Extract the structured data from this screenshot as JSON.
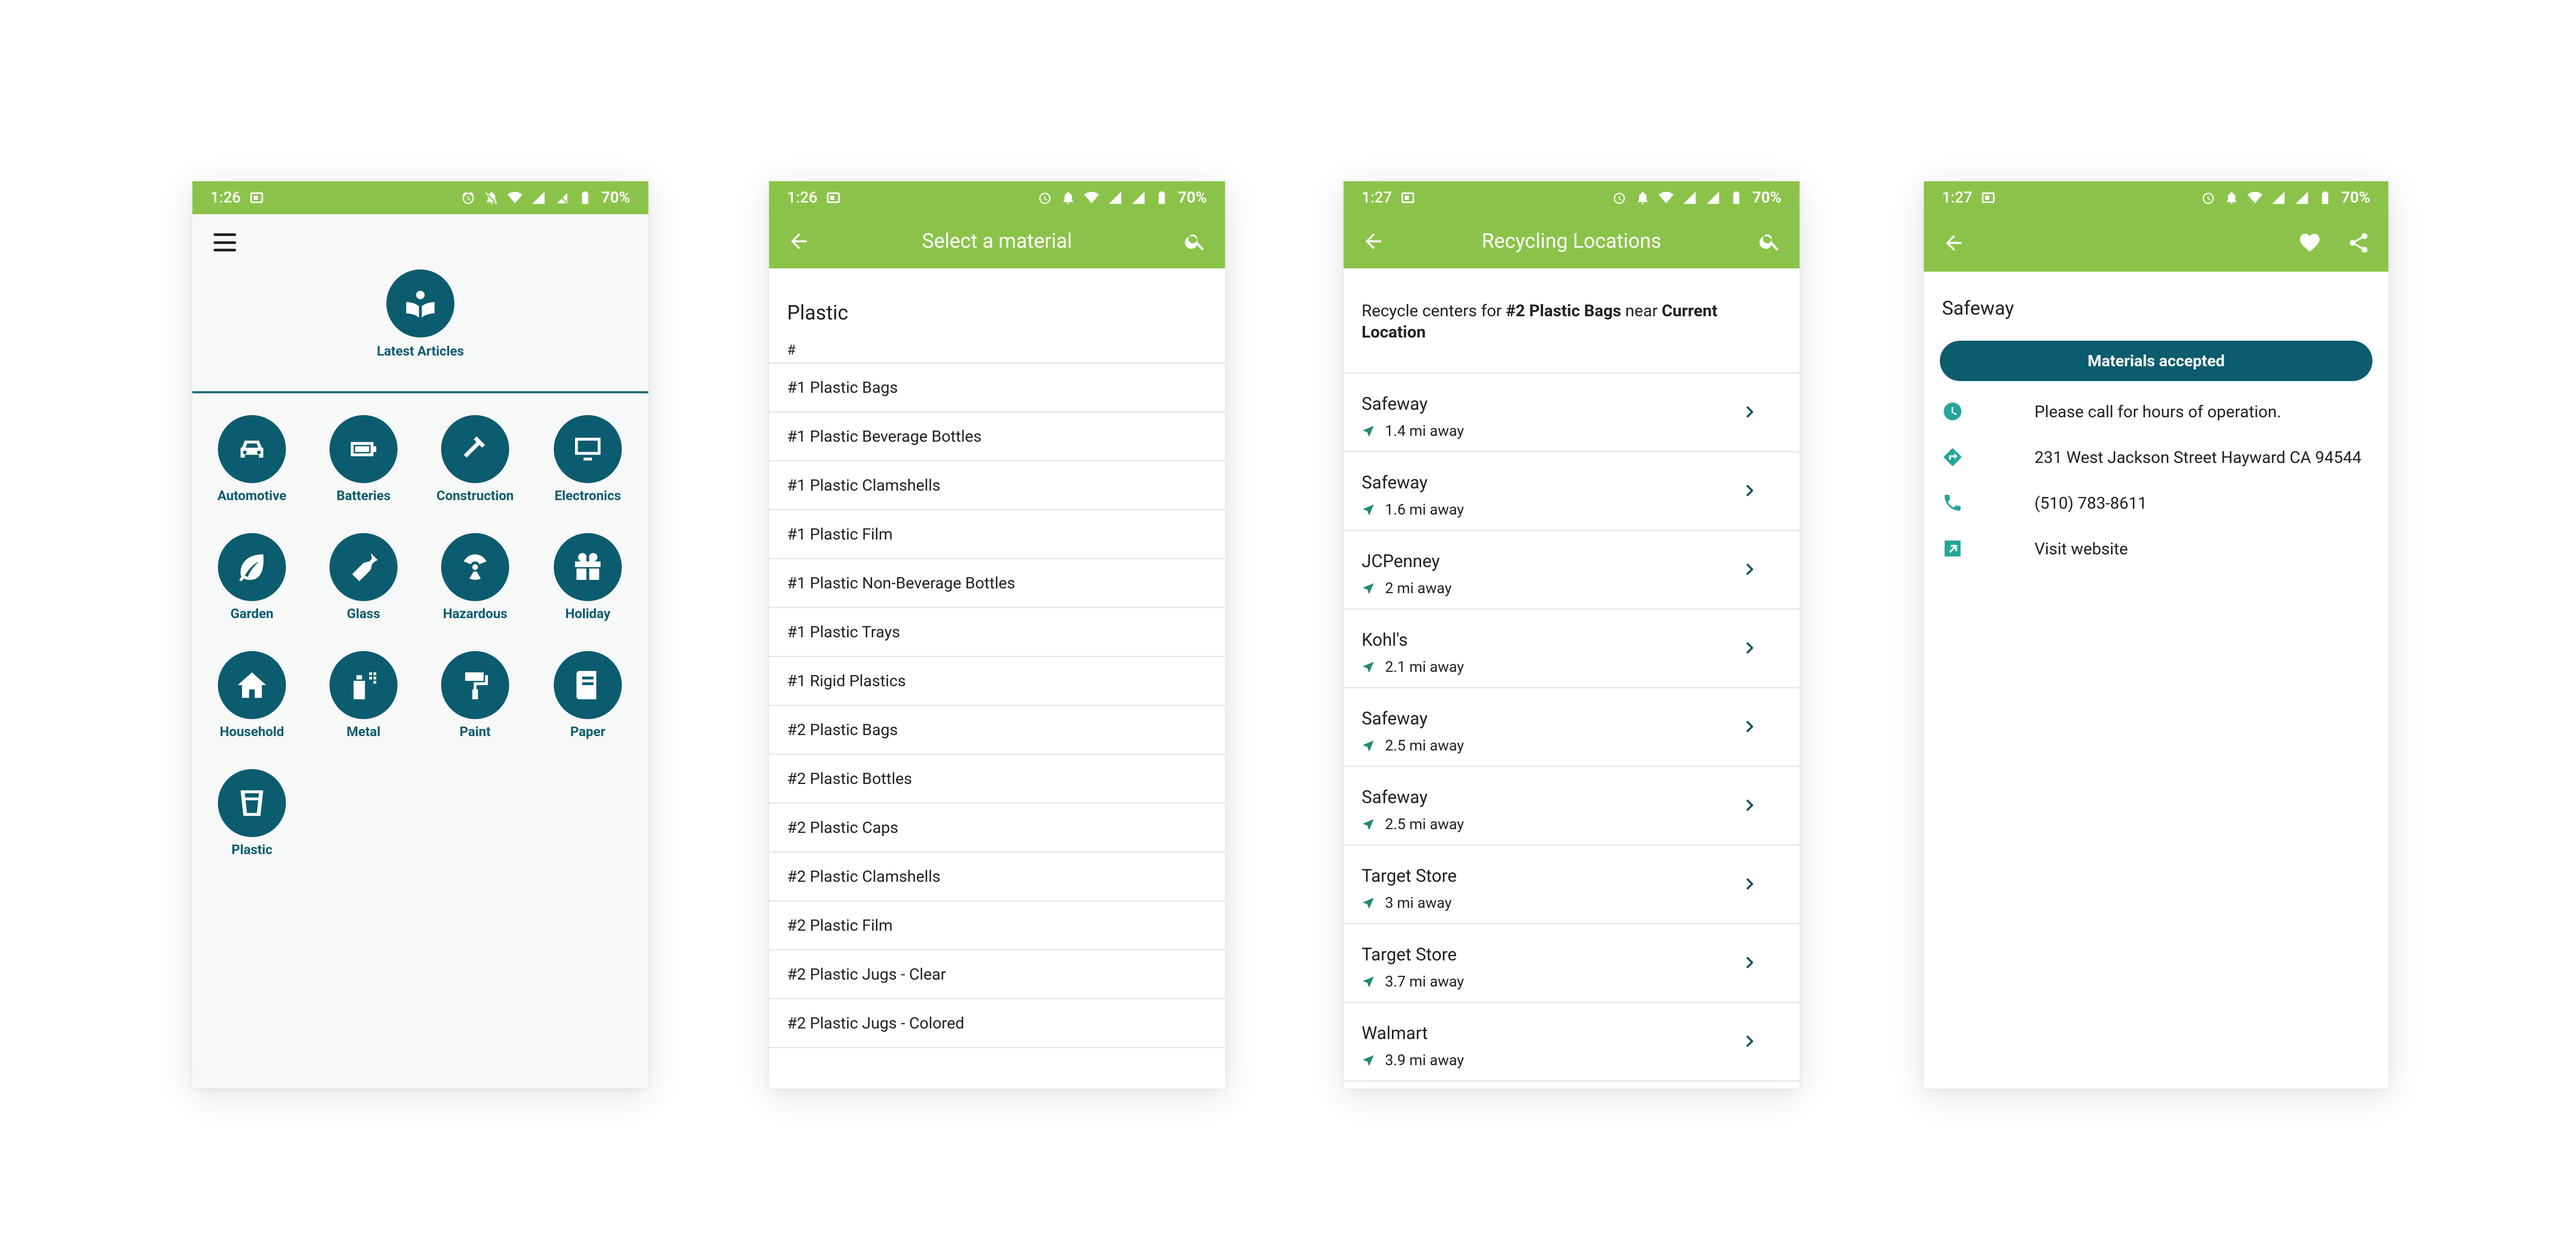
{
  "status": [
    {
      "time": "1:26",
      "battery": "70%"
    },
    {
      "time": "1:26",
      "battery": "70%"
    },
    {
      "time": "1:27",
      "battery": "70%"
    },
    {
      "time": "1:27",
      "battery": "70%"
    }
  ],
  "colors": {
    "primary_green": "#8bc34a",
    "teal": "#0b5c6e",
    "icon_teal": "#26a69a"
  },
  "home": {
    "articles_label": "Latest Articles",
    "categories": [
      {
        "label": "Automotive",
        "icon": "car-icon"
      },
      {
        "label": "Batteries",
        "icon": "battery-icon"
      },
      {
        "label": "Construction",
        "icon": "hammer-icon"
      },
      {
        "label": "Electronics",
        "icon": "monitor-icon"
      },
      {
        "label": "Garden",
        "icon": "leaf-icon"
      },
      {
        "label": "Glass",
        "icon": "bottle-icon"
      },
      {
        "label": "Hazardous",
        "icon": "radiation-icon"
      },
      {
        "label": "Holiday",
        "icon": "gift-icon"
      },
      {
        "label": "Household",
        "icon": "home-icon"
      },
      {
        "label": "Metal",
        "icon": "spray-can-icon"
      },
      {
        "label": "Paint",
        "icon": "paint-roller-icon"
      },
      {
        "label": "Paper",
        "icon": "book-icon"
      },
      {
        "label": "Plastic",
        "icon": "cup-icon"
      }
    ]
  },
  "materials": {
    "appbar_title": "Select a material",
    "section_title": "Plastic",
    "group_header": "#",
    "items": [
      "#1 Plastic Bags",
      "#1 Plastic Beverage Bottles",
      "#1 Plastic Clamshells",
      "#1 Plastic Film",
      "#1 Plastic Non-Beverage Bottles",
      "#1 Plastic Trays",
      "#1 Rigid Plastics",
      "#2 Plastic Bags",
      "#2 Plastic Bottles",
      "#2 Plastic Caps",
      "#2 Plastic Clamshells",
      "#2 Plastic Film",
      "#2 Plastic Jugs - Clear",
      "#2 Plastic Jugs - Colored"
    ]
  },
  "locations": {
    "appbar_title": "Recycling Locations",
    "header_prefix": "Recycle centers for ",
    "header_material": "#2 Plastic Bags",
    "header_mid": " near ",
    "header_place": "Current Location",
    "items": [
      {
        "name": "Safeway",
        "distance": "1.4 mi away"
      },
      {
        "name": "Safeway",
        "distance": "1.6 mi away"
      },
      {
        "name": "JCPenney",
        "distance": "2 mi away"
      },
      {
        "name": "Kohl's",
        "distance": "2.1 mi away"
      },
      {
        "name": "Safeway",
        "distance": "2.5 mi away"
      },
      {
        "name": "Safeway",
        "distance": "2.5 mi away"
      },
      {
        "name": "Target Store",
        "distance": "3 mi away"
      },
      {
        "name": "Target Store",
        "distance": "3.7 mi away"
      },
      {
        "name": "Walmart",
        "distance": "3.9 mi away"
      }
    ]
  },
  "detail": {
    "title": "Safeway",
    "materials_button": "Materials accepted",
    "hours": "Please call for hours of operation.",
    "address": "231 West Jackson Street Hayward CA 94544",
    "phone": "(510) 783-8611",
    "website": "Visit website"
  }
}
